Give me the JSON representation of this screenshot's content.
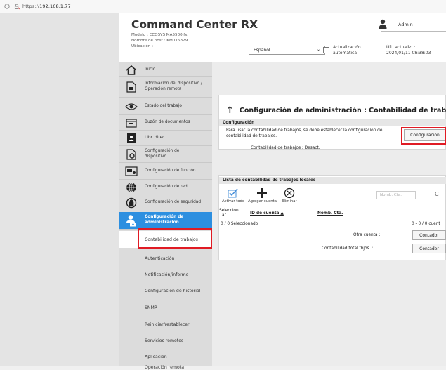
{
  "browser": {
    "url_prefix": "https://",
    "url_host": "192.168.1.77"
  },
  "header": {
    "title": "Command Center RX",
    "model": "Modelo : ECOSYS MA5500ifx",
    "host": "Nombre de host : KM076829",
    "location": "Ubicación :",
    "admin_label": "Admin",
    "language": "Español",
    "auto_update_line1": "Actualización",
    "auto_update_line2": "automática",
    "last_update_label": "Últ. actualiz. :",
    "last_update_value": "2024/01/11 08:38:03"
  },
  "sidebar": {
    "items": [
      {
        "label": "Inicio",
        "icon": "home-icon"
      },
      {
        "label": "Información del dispositivo / Operación remota",
        "icon": "device-info-icon"
      },
      {
        "label": "Estado del trabajo",
        "icon": "eye-icon"
      },
      {
        "label": "Buzón de documentos",
        "icon": "document-box-icon"
      },
      {
        "label": "Libr. direc.",
        "icon": "address-book-icon"
      },
      {
        "label": "Configuración de dispositivo",
        "icon": "device-settings-icon"
      },
      {
        "label": "Configuración de función",
        "icon": "function-settings-icon"
      },
      {
        "label": "Configuración de red",
        "icon": "globe-icon"
      },
      {
        "label": "Configuración de seguridad",
        "icon": "security-icon"
      },
      {
        "label": "Configuración de administración",
        "icon": "admin-user-icon"
      }
    ],
    "subitems": [
      "Contabilidad de trabajos",
      "Autenticación",
      "Notificación/informe",
      "Configuración de historial",
      "SNMP",
      "Reiniciar/restablecer",
      "Servicios remotos",
      "Aplicación",
      "Operación remota"
    ]
  },
  "page": {
    "title": "Configuración de administración : Contabilidad de trabajos",
    "config_section": "Configuración",
    "config_desc_line1": "Para usar la contabilidad de trabajos, se debe establecer la configuración de",
    "config_desc_line2": "contabilidad de trabajos.",
    "status_label": "Contabilidad de trabajos :",
    "status_value": "Desact.",
    "config_button": "Configuración",
    "list_section": "Lista de contabilidad de trabajos locales",
    "tools": {
      "activate_all": "Activar todo",
      "add_account": "Agregar cuenta",
      "delete": "Eliminar"
    },
    "search_placeholder": "Nomb. Cta.",
    "columns": {
      "select_line1": "Seleccion",
      "select_line2": "ar",
      "account_id": "ID de cuenta ▲",
      "account_name": "Nomb. Cta."
    },
    "selected_count": "0 / 0 Seleccionado",
    "range": "0 - 0 / 0 cuent",
    "other_account_label": "Otra cuenta :",
    "total_jobs_label": "Contabilidad total tbjos. :",
    "counter_button": "Contador"
  }
}
